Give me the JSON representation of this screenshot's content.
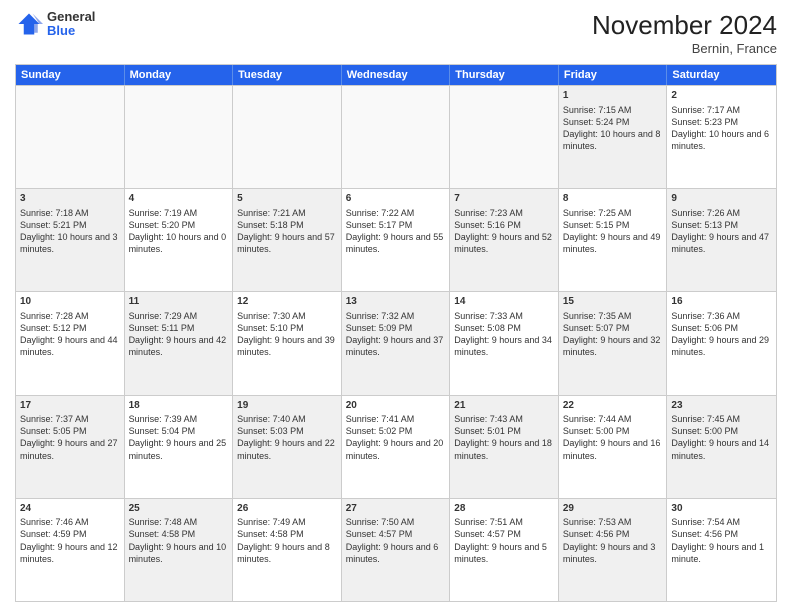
{
  "logo": {
    "general": "General",
    "blue": "Blue"
  },
  "title": "November 2024",
  "subtitle": "Bernin, France",
  "days": [
    "Sunday",
    "Monday",
    "Tuesday",
    "Wednesday",
    "Thursday",
    "Friday",
    "Saturday"
  ],
  "rows": [
    [
      {
        "day": "",
        "info": "",
        "empty": true
      },
      {
        "day": "",
        "info": "",
        "empty": true
      },
      {
        "day": "",
        "info": "",
        "empty": true
      },
      {
        "day": "",
        "info": "",
        "empty": true
      },
      {
        "day": "",
        "info": "",
        "empty": true
      },
      {
        "day": "1",
        "info": "Sunrise: 7:15 AM\nSunset: 5:24 PM\nDaylight: 10 hours and 8 minutes.",
        "shaded": true
      },
      {
        "day": "2",
        "info": "Sunrise: 7:17 AM\nSunset: 5:23 PM\nDaylight: 10 hours and 6 minutes.",
        "shaded": false
      }
    ],
    [
      {
        "day": "3",
        "info": "Sunrise: 7:18 AM\nSunset: 5:21 PM\nDaylight: 10 hours and 3 minutes.",
        "shaded": true
      },
      {
        "day": "4",
        "info": "Sunrise: 7:19 AM\nSunset: 5:20 PM\nDaylight: 10 hours and 0 minutes.",
        "shaded": false
      },
      {
        "day": "5",
        "info": "Sunrise: 7:21 AM\nSunset: 5:18 PM\nDaylight: 9 hours and 57 minutes.",
        "shaded": true
      },
      {
        "day": "6",
        "info": "Sunrise: 7:22 AM\nSunset: 5:17 PM\nDaylight: 9 hours and 55 minutes.",
        "shaded": false
      },
      {
        "day": "7",
        "info": "Sunrise: 7:23 AM\nSunset: 5:16 PM\nDaylight: 9 hours and 52 minutes.",
        "shaded": true
      },
      {
        "day": "8",
        "info": "Sunrise: 7:25 AM\nSunset: 5:15 PM\nDaylight: 9 hours and 49 minutes.",
        "shaded": false
      },
      {
        "day": "9",
        "info": "Sunrise: 7:26 AM\nSunset: 5:13 PM\nDaylight: 9 hours and 47 minutes.",
        "shaded": true
      }
    ],
    [
      {
        "day": "10",
        "info": "Sunrise: 7:28 AM\nSunset: 5:12 PM\nDaylight: 9 hours and 44 minutes.",
        "shaded": false
      },
      {
        "day": "11",
        "info": "Sunrise: 7:29 AM\nSunset: 5:11 PM\nDaylight: 9 hours and 42 minutes.",
        "shaded": true
      },
      {
        "day": "12",
        "info": "Sunrise: 7:30 AM\nSunset: 5:10 PM\nDaylight: 9 hours and 39 minutes.",
        "shaded": false
      },
      {
        "day": "13",
        "info": "Sunrise: 7:32 AM\nSunset: 5:09 PM\nDaylight: 9 hours and 37 minutes.",
        "shaded": true
      },
      {
        "day": "14",
        "info": "Sunrise: 7:33 AM\nSunset: 5:08 PM\nDaylight: 9 hours and 34 minutes.",
        "shaded": false
      },
      {
        "day": "15",
        "info": "Sunrise: 7:35 AM\nSunset: 5:07 PM\nDaylight: 9 hours and 32 minutes.",
        "shaded": true
      },
      {
        "day": "16",
        "info": "Sunrise: 7:36 AM\nSunset: 5:06 PM\nDaylight: 9 hours and 29 minutes.",
        "shaded": false
      }
    ],
    [
      {
        "day": "17",
        "info": "Sunrise: 7:37 AM\nSunset: 5:05 PM\nDaylight: 9 hours and 27 minutes.",
        "shaded": true
      },
      {
        "day": "18",
        "info": "Sunrise: 7:39 AM\nSunset: 5:04 PM\nDaylight: 9 hours and 25 minutes.",
        "shaded": false
      },
      {
        "day": "19",
        "info": "Sunrise: 7:40 AM\nSunset: 5:03 PM\nDaylight: 9 hours and 22 minutes.",
        "shaded": true
      },
      {
        "day": "20",
        "info": "Sunrise: 7:41 AM\nSunset: 5:02 PM\nDaylight: 9 hours and 20 minutes.",
        "shaded": false
      },
      {
        "day": "21",
        "info": "Sunrise: 7:43 AM\nSunset: 5:01 PM\nDaylight: 9 hours and 18 minutes.",
        "shaded": true
      },
      {
        "day": "22",
        "info": "Sunrise: 7:44 AM\nSunset: 5:00 PM\nDaylight: 9 hours and 16 minutes.",
        "shaded": false
      },
      {
        "day": "23",
        "info": "Sunrise: 7:45 AM\nSunset: 5:00 PM\nDaylight: 9 hours and 14 minutes.",
        "shaded": true
      }
    ],
    [
      {
        "day": "24",
        "info": "Sunrise: 7:46 AM\nSunset: 4:59 PM\nDaylight: 9 hours and 12 minutes.",
        "shaded": false
      },
      {
        "day": "25",
        "info": "Sunrise: 7:48 AM\nSunset: 4:58 PM\nDaylight: 9 hours and 10 minutes.",
        "shaded": true
      },
      {
        "day": "26",
        "info": "Sunrise: 7:49 AM\nSunset: 4:58 PM\nDaylight: 9 hours and 8 minutes.",
        "shaded": false
      },
      {
        "day": "27",
        "info": "Sunrise: 7:50 AM\nSunset: 4:57 PM\nDaylight: 9 hours and 6 minutes.",
        "shaded": true
      },
      {
        "day": "28",
        "info": "Sunrise: 7:51 AM\nSunset: 4:57 PM\nDaylight: 9 hours and 5 minutes.",
        "shaded": false
      },
      {
        "day": "29",
        "info": "Sunrise: 7:53 AM\nSunset: 4:56 PM\nDaylight: 9 hours and 3 minutes.",
        "shaded": true
      },
      {
        "day": "30",
        "info": "Sunrise: 7:54 AM\nSunset: 4:56 PM\nDaylight: 9 hours and 1 minute.",
        "shaded": false
      }
    ]
  ]
}
